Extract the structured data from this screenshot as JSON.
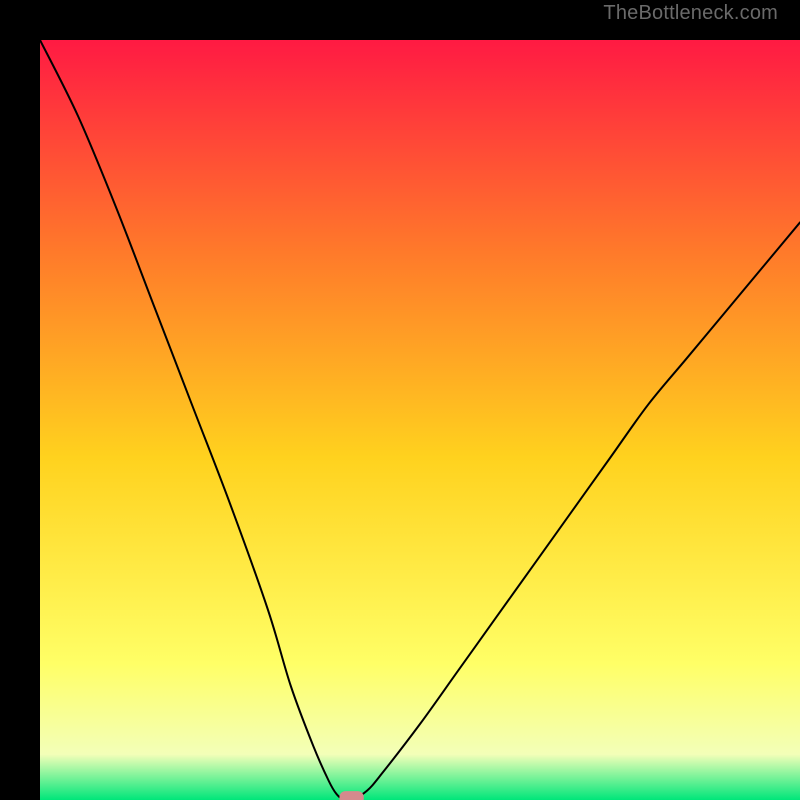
{
  "watermark": "TheBottleneck.com",
  "chart_data": {
    "type": "line",
    "title": "",
    "xlabel": "",
    "ylabel": "",
    "xlim": [
      0,
      100
    ],
    "ylim": [
      0,
      100
    ],
    "grid": false,
    "gradient_colors": {
      "top": "#ff1a43",
      "upper_mid": "#ff7a2a",
      "mid": "#ffd21e",
      "lower_mid": "#ffff66",
      "near_bottom": "#f3ffb8",
      "bottom": "#00e67a"
    },
    "curve": {
      "description": "V-shaped bottleneck curve with minimum near x≈40",
      "color": "#000000",
      "stroke_width": 2,
      "x": [
        0,
        5,
        10,
        15,
        20,
        25,
        30,
        33,
        36,
        38,
        39,
        40,
        41,
        43,
        45,
        50,
        55,
        60,
        65,
        70,
        75,
        80,
        85,
        90,
        95,
        100
      ],
      "y": [
        100,
        90,
        78,
        65,
        52,
        39,
        25,
        15,
        7,
        2.5,
        0.8,
        0,
        0,
        1.2,
        3.5,
        10,
        17,
        24,
        31,
        38,
        45,
        52,
        58,
        64,
        70,
        76
      ]
    },
    "marker": {
      "description": "Small rounded pink marker at the curve minimum",
      "x": 41,
      "y": 0,
      "width": 3.2,
      "height": 1.8,
      "color": "#d58a8d"
    }
  }
}
